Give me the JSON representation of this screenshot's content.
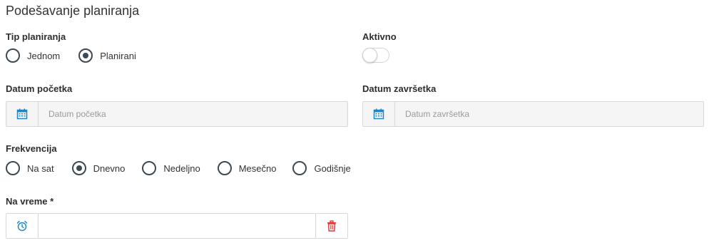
{
  "title": "Podešavanje planiranja",
  "plan_type": {
    "label": "Tip planiranja",
    "options": [
      "Jednom",
      "Planirani"
    ],
    "selected": "Planirani"
  },
  "active": {
    "label": "Aktivno",
    "enabled": false
  },
  "start_date": {
    "label": "Datum početka",
    "placeholder": "Datum početka",
    "value": ""
  },
  "end_date": {
    "label": "Datum završetka",
    "placeholder": "Datum završetka",
    "value": ""
  },
  "frequency": {
    "label": "Frekvencija",
    "options": [
      "Na sat",
      "Dnevno",
      "Nedeljno",
      "Mesečno",
      "Godišnje"
    ],
    "selected": "Dnevno"
  },
  "time": {
    "label": "Na vreme *",
    "value": ""
  },
  "colors": {
    "accent": "#1e88c7",
    "danger": "#e53935",
    "radio": "#3b4a55"
  },
  "icons": {
    "start_date": "calendar-icon",
    "end_date": "calendar-icon",
    "time": "alarm-clock-icon",
    "clear_time": "trash-icon"
  }
}
